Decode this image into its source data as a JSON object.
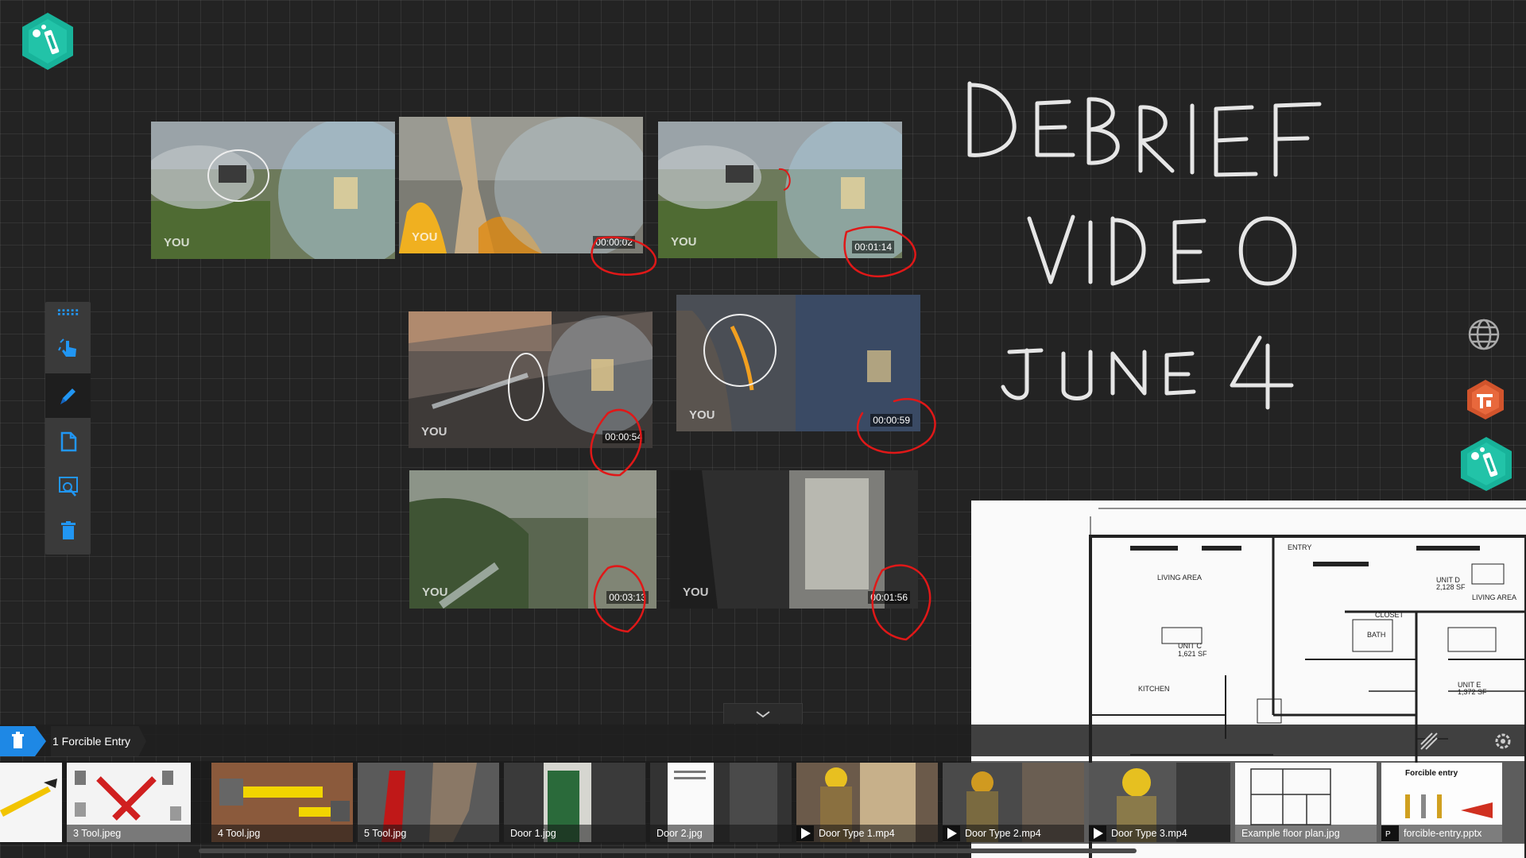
{
  "board": {
    "handwriting": [
      "DEBRIEF",
      "VIDEO",
      "JUNE 4"
    ]
  },
  "videos": [
    {
      "id": "v1",
      "watermark": "YOU",
      "timestamp": ""
    },
    {
      "id": "v2",
      "watermark": "YOU",
      "timestamp": "00:00:02"
    },
    {
      "id": "v3",
      "watermark": "YOU",
      "timestamp": "00:01:14"
    },
    {
      "id": "v4",
      "watermark": "YOU",
      "timestamp": "00:00:54"
    },
    {
      "id": "v5",
      "watermark": "YOU",
      "timestamp": "00:00:59"
    },
    {
      "id": "v6",
      "watermark": "YOU",
      "timestamp": "00:03:13"
    },
    {
      "id": "v7",
      "watermark": "YOU",
      "timestamp": "00:01:56"
    }
  ],
  "toolbar": {
    "items": [
      {
        "name": "drag-handle-icon"
      },
      {
        "name": "touch-select-icon"
      },
      {
        "name": "pen-icon",
        "active": true
      },
      {
        "name": "page-icon"
      },
      {
        "name": "zoom-icon"
      },
      {
        "name": "trash-icon"
      }
    ],
    "accent": "#2196f3"
  },
  "tray": {
    "breadcrumb": "1 Forcible Entry",
    "items": [
      {
        "label": "",
        "kind": "image"
      },
      {
        "label": "3 Tool.jpeg",
        "kind": "image"
      },
      {
        "label": "4 Tool.jpg",
        "kind": "image"
      },
      {
        "label": "5 Tool.jpg",
        "kind": "image"
      },
      {
        "label": "Door 1.jpg",
        "kind": "image"
      },
      {
        "label": "Door 2.jpg",
        "kind": "image"
      },
      {
        "label": "Door Type 1.mp4",
        "kind": "video"
      },
      {
        "label": "Door Type 2.mp4",
        "kind": "video"
      },
      {
        "label": "Door Type 3.mp4",
        "kind": "video"
      },
      {
        "label": "Example floor plan.jpg",
        "kind": "image"
      },
      {
        "label": "forcible-entry.pptx",
        "kind": "pptx",
        "title": "Forcible entry"
      }
    ]
  },
  "floorplan": {
    "labels": [
      "LIVING AREA",
      "ENTRY",
      "UNIT C",
      "1,621 SF",
      "KITCHEN",
      "BATH",
      "UNIT D",
      "2,128 SF",
      "UNIT E",
      "1,372 SF",
      "CLOSET",
      "LIVING AREA"
    ]
  },
  "colors": {
    "background": "#232323",
    "annotation_red": "#e01818",
    "annotation_white": "#e6e6e6",
    "brand_teal": "#18b39a"
  }
}
